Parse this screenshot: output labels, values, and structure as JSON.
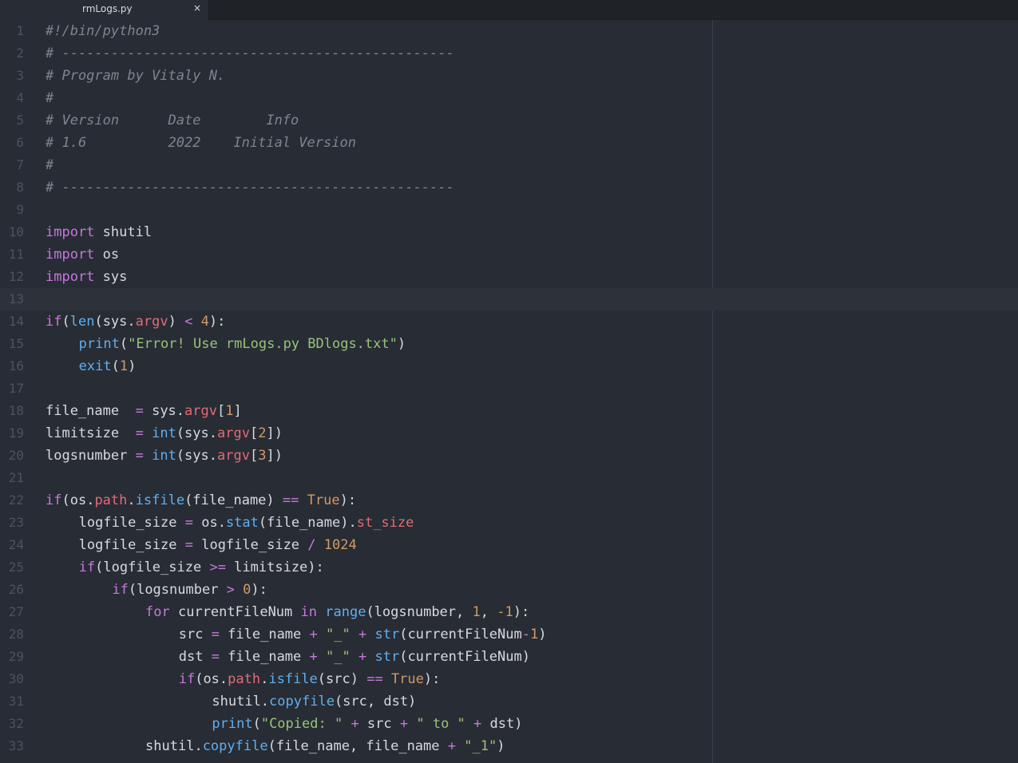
{
  "tab": {
    "filename": "rmLogs.py",
    "close_glyph": "×"
  },
  "editor": {
    "current_line": 13,
    "lines": [
      {
        "n": "1",
        "indent": 0,
        "tokens": [
          {
            "t": "c",
            "v": "#!/bin/python3"
          }
        ]
      },
      {
        "n": "2",
        "indent": 0,
        "tokens": [
          {
            "t": "c",
            "v": "# ------------------------------------------------"
          }
        ]
      },
      {
        "n": "3",
        "indent": 0,
        "tokens": [
          {
            "t": "c",
            "v": "# Program by Vitaly N."
          }
        ]
      },
      {
        "n": "4",
        "indent": 0,
        "tokens": [
          {
            "t": "c",
            "v": "#"
          }
        ]
      },
      {
        "n": "5",
        "indent": 0,
        "tokens": [
          {
            "t": "c",
            "v": "# Version      Date        Info"
          }
        ]
      },
      {
        "n": "6",
        "indent": 0,
        "tokens": [
          {
            "t": "c",
            "v": "# 1.6          2022    Initial Version"
          }
        ]
      },
      {
        "n": "7",
        "indent": 0,
        "tokens": [
          {
            "t": "c",
            "v": "#"
          }
        ]
      },
      {
        "n": "8",
        "indent": 0,
        "tokens": [
          {
            "t": "c",
            "v": "# ------------------------------------------------"
          }
        ]
      },
      {
        "n": "9",
        "indent": 0,
        "tokens": []
      },
      {
        "n": "10",
        "indent": 0,
        "tokens": [
          {
            "t": "k",
            "v": "import"
          },
          {
            "t": "p",
            "v": " shutil"
          }
        ]
      },
      {
        "n": "11",
        "indent": 0,
        "tokens": [
          {
            "t": "k",
            "v": "import"
          },
          {
            "t": "p",
            "v": " os"
          }
        ]
      },
      {
        "n": "12",
        "indent": 0,
        "tokens": [
          {
            "t": "k",
            "v": "import"
          },
          {
            "t": "p",
            "v": " sys"
          }
        ]
      },
      {
        "n": "13",
        "indent": 0,
        "tokens": []
      },
      {
        "n": "14",
        "indent": 0,
        "tokens": [
          {
            "t": "k",
            "v": "if"
          },
          {
            "t": "p",
            "v": "("
          },
          {
            "t": "f",
            "v": "len"
          },
          {
            "t": "p",
            "v": "(sys."
          },
          {
            "t": "a",
            "v": "argv"
          },
          {
            "t": "p",
            "v": ") "
          },
          {
            "t": "o",
            "v": "<"
          },
          {
            "t": "p",
            "v": " "
          },
          {
            "t": "n",
            "v": "4"
          },
          {
            "t": "p",
            "v": "):"
          }
        ]
      },
      {
        "n": "15",
        "indent": 4,
        "tokens": [
          {
            "t": "f",
            "v": "print"
          },
          {
            "t": "p",
            "v": "("
          },
          {
            "t": "s",
            "v": "\"Error! Use rmLogs.py BDlogs.txt\""
          },
          {
            "t": "p",
            "v": ")"
          }
        ]
      },
      {
        "n": "16",
        "indent": 4,
        "tokens": [
          {
            "t": "f",
            "v": "exit"
          },
          {
            "t": "p",
            "v": "("
          },
          {
            "t": "n",
            "v": "1"
          },
          {
            "t": "p",
            "v": ")"
          }
        ]
      },
      {
        "n": "17",
        "indent": 0,
        "tokens": []
      },
      {
        "n": "18",
        "indent": 0,
        "tokens": [
          {
            "t": "p",
            "v": "file_name  "
          },
          {
            "t": "o",
            "v": "="
          },
          {
            "t": "p",
            "v": " sys."
          },
          {
            "t": "a",
            "v": "argv"
          },
          {
            "t": "p",
            "v": "["
          },
          {
            "t": "n",
            "v": "1"
          },
          {
            "t": "p",
            "v": "]"
          }
        ]
      },
      {
        "n": "19",
        "indent": 0,
        "tokens": [
          {
            "t": "p",
            "v": "limitsize  "
          },
          {
            "t": "o",
            "v": "="
          },
          {
            "t": "p",
            "v": " "
          },
          {
            "t": "f",
            "v": "int"
          },
          {
            "t": "p",
            "v": "(sys."
          },
          {
            "t": "a",
            "v": "argv"
          },
          {
            "t": "p",
            "v": "["
          },
          {
            "t": "n",
            "v": "2"
          },
          {
            "t": "p",
            "v": "])"
          }
        ]
      },
      {
        "n": "20",
        "indent": 0,
        "tokens": [
          {
            "t": "p",
            "v": "logsnumber "
          },
          {
            "t": "o",
            "v": "="
          },
          {
            "t": "p",
            "v": " "
          },
          {
            "t": "f",
            "v": "int"
          },
          {
            "t": "p",
            "v": "(sys."
          },
          {
            "t": "a",
            "v": "argv"
          },
          {
            "t": "p",
            "v": "["
          },
          {
            "t": "n",
            "v": "3"
          },
          {
            "t": "p",
            "v": "])"
          }
        ]
      },
      {
        "n": "21",
        "indent": 0,
        "tokens": []
      },
      {
        "n": "22",
        "indent": 0,
        "tokens": [
          {
            "t": "k",
            "v": "if"
          },
          {
            "t": "p",
            "v": "(os."
          },
          {
            "t": "a",
            "v": "path"
          },
          {
            "t": "p",
            "v": "."
          },
          {
            "t": "f",
            "v": "isfile"
          },
          {
            "t": "p",
            "v": "(file_name) "
          },
          {
            "t": "o",
            "v": "=="
          },
          {
            "t": "p",
            "v": " "
          },
          {
            "t": "n",
            "v": "True"
          },
          {
            "t": "p",
            "v": "):"
          }
        ]
      },
      {
        "n": "23",
        "indent": 4,
        "tokens": [
          {
            "t": "p",
            "v": "logfile_size "
          },
          {
            "t": "o",
            "v": "="
          },
          {
            "t": "p",
            "v": " os."
          },
          {
            "t": "f",
            "v": "stat"
          },
          {
            "t": "p",
            "v": "(file_name)."
          },
          {
            "t": "a",
            "v": "st_size"
          }
        ]
      },
      {
        "n": "24",
        "indent": 4,
        "tokens": [
          {
            "t": "p",
            "v": "logfile_size "
          },
          {
            "t": "o",
            "v": "="
          },
          {
            "t": "p",
            "v": " logfile_size "
          },
          {
            "t": "o",
            "v": "/"
          },
          {
            "t": "p",
            "v": " "
          },
          {
            "t": "n",
            "v": "1024"
          }
        ]
      },
      {
        "n": "25",
        "indent": 4,
        "tokens": [
          {
            "t": "k",
            "v": "if"
          },
          {
            "t": "p",
            "v": "(logfile_size "
          },
          {
            "t": "o",
            "v": ">="
          },
          {
            "t": "p",
            "v": " limitsize):"
          }
        ]
      },
      {
        "n": "26",
        "indent": 8,
        "tokens": [
          {
            "t": "k",
            "v": "if"
          },
          {
            "t": "p",
            "v": "(logsnumber "
          },
          {
            "t": "o",
            "v": ">"
          },
          {
            "t": "p",
            "v": " "
          },
          {
            "t": "n",
            "v": "0"
          },
          {
            "t": "p",
            "v": "):"
          }
        ]
      },
      {
        "n": "27",
        "indent": 12,
        "tokens": [
          {
            "t": "k",
            "v": "for"
          },
          {
            "t": "p",
            "v": " currentFileNum "
          },
          {
            "t": "k",
            "v": "in"
          },
          {
            "t": "p",
            "v": " "
          },
          {
            "t": "f",
            "v": "range"
          },
          {
            "t": "p",
            "v": "(logsnumber, "
          },
          {
            "t": "n",
            "v": "1"
          },
          {
            "t": "p",
            "v": ", "
          },
          {
            "t": "n",
            "v": "-1"
          },
          {
            "t": "p",
            "v": "):"
          }
        ]
      },
      {
        "n": "28",
        "indent": 16,
        "tokens": [
          {
            "t": "p",
            "v": "src "
          },
          {
            "t": "o",
            "v": "="
          },
          {
            "t": "p",
            "v": " file_name "
          },
          {
            "t": "o",
            "v": "+"
          },
          {
            "t": "p",
            "v": " "
          },
          {
            "t": "s",
            "v": "\"_\""
          },
          {
            "t": "p",
            "v": " "
          },
          {
            "t": "o",
            "v": "+"
          },
          {
            "t": "p",
            "v": " "
          },
          {
            "t": "f",
            "v": "str"
          },
          {
            "t": "p",
            "v": "(currentFileNum"
          },
          {
            "t": "o",
            "v": "-"
          },
          {
            "t": "n",
            "v": "1"
          },
          {
            "t": "p",
            "v": ")"
          }
        ]
      },
      {
        "n": "29",
        "indent": 16,
        "tokens": [
          {
            "t": "p",
            "v": "dst "
          },
          {
            "t": "o",
            "v": "="
          },
          {
            "t": "p",
            "v": " file_name "
          },
          {
            "t": "o",
            "v": "+"
          },
          {
            "t": "p",
            "v": " "
          },
          {
            "t": "s",
            "v": "\"_\""
          },
          {
            "t": "p",
            "v": " "
          },
          {
            "t": "o",
            "v": "+"
          },
          {
            "t": "p",
            "v": " "
          },
          {
            "t": "f",
            "v": "str"
          },
          {
            "t": "p",
            "v": "(currentFileNum)"
          }
        ]
      },
      {
        "n": "30",
        "indent": 16,
        "tokens": [
          {
            "t": "k",
            "v": "if"
          },
          {
            "t": "p",
            "v": "(os."
          },
          {
            "t": "a",
            "v": "path"
          },
          {
            "t": "p",
            "v": "."
          },
          {
            "t": "f",
            "v": "isfile"
          },
          {
            "t": "p",
            "v": "(src) "
          },
          {
            "t": "o",
            "v": "=="
          },
          {
            "t": "p",
            "v": " "
          },
          {
            "t": "n",
            "v": "True"
          },
          {
            "t": "p",
            "v": "):"
          }
        ]
      },
      {
        "n": "31",
        "indent": 20,
        "tokens": [
          {
            "t": "p",
            "v": "shutil."
          },
          {
            "t": "f",
            "v": "copyfile"
          },
          {
            "t": "p",
            "v": "(src, dst)"
          }
        ]
      },
      {
        "n": "32",
        "indent": 20,
        "tokens": [
          {
            "t": "f",
            "v": "print"
          },
          {
            "t": "p",
            "v": "("
          },
          {
            "t": "s",
            "v": "\"Copied: \""
          },
          {
            "t": "p",
            "v": " "
          },
          {
            "t": "o",
            "v": "+"
          },
          {
            "t": "p",
            "v": " src "
          },
          {
            "t": "o",
            "v": "+"
          },
          {
            "t": "p",
            "v": " "
          },
          {
            "t": "s",
            "v": "\" to \""
          },
          {
            "t": "p",
            "v": " "
          },
          {
            "t": "o",
            "v": "+"
          },
          {
            "t": "p",
            "v": " dst)"
          }
        ]
      },
      {
        "n": "33",
        "indent": 12,
        "tokens": [
          {
            "t": "p",
            "v": "shutil."
          },
          {
            "t": "f",
            "v": "copyfile"
          },
          {
            "t": "p",
            "v": "(file_name, file_name "
          },
          {
            "t": "o",
            "v": "+"
          },
          {
            "t": "p",
            "v": " "
          },
          {
            "t": "s",
            "v": "\"_1\""
          },
          {
            "t": "p",
            "v": ")"
          }
        ]
      }
    ]
  },
  "colors": {
    "background": "#282c34",
    "comment": "#7f848e",
    "keyword": "#c678dd",
    "function": "#61afef",
    "string": "#98c379",
    "number": "#d19a66",
    "attribute": "#e06c75",
    "plain": "#d7dae0"
  }
}
